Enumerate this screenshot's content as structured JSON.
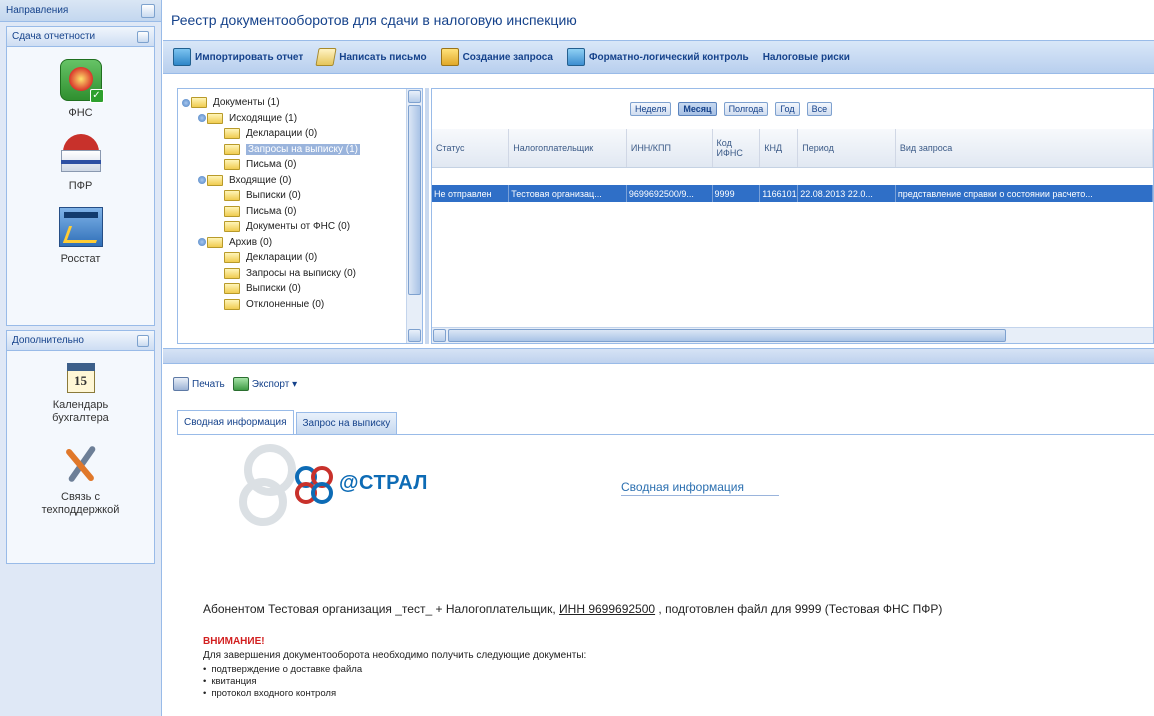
{
  "nav": {
    "header": "Направления",
    "groups": [
      {
        "title": "Сдача отчетности",
        "items": [
          {
            "label": "ФНС",
            "icon": "fns-icon"
          },
          {
            "label": "ПФР",
            "icon": "pfr-icon"
          },
          {
            "label": "Росстат",
            "icon": "rosstat-icon"
          }
        ]
      },
      {
        "title": "Дополнительно",
        "items": [
          {
            "label": "Календарь бухгалтера",
            "icon": "calendar-icon",
            "icon_text": "15"
          },
          {
            "label": "Связь с техподдержкой",
            "icon": "tools-icon"
          }
        ]
      }
    ]
  },
  "page": {
    "title": "Реестр документооборотов для сдачи в налоговую инспекцию"
  },
  "toolbar": {
    "buttons": [
      {
        "label": "Импортировать отчет",
        "icon": "import-icon"
      },
      {
        "label": "Написать письмо",
        "icon": "letter-icon"
      },
      {
        "label": "Создание запроса",
        "icon": "request-icon"
      },
      {
        "label": "Форматно-логический контроль",
        "icon": "check-icon"
      },
      {
        "label": "Налоговые риски",
        "icon": ""
      }
    ]
  },
  "tree": {
    "rows": [
      {
        "label": "Документы (1)",
        "level": 0,
        "expanded": true
      },
      {
        "label": "Исходящие (1)",
        "level": 1,
        "expanded": true
      },
      {
        "label": "Декларации (0)",
        "level": 2
      },
      {
        "label": "Запросы на выписку (1)",
        "level": 2,
        "selected": true
      },
      {
        "label": "Письма (0)",
        "level": 2
      },
      {
        "label": "Входящие (0)",
        "level": 1,
        "expanded": true
      },
      {
        "label": "Выписки (0)",
        "level": 2
      },
      {
        "label": "Письма (0)",
        "level": 2
      },
      {
        "label": "Документы от ФНС (0)",
        "level": 2
      },
      {
        "label": "Архив (0)",
        "level": 1,
        "expanded": true
      },
      {
        "label": "Декларации (0)",
        "level": 2
      },
      {
        "label": "Запросы на выписку (0)",
        "level": 2
      },
      {
        "label": "Выписки (0)",
        "level": 2
      },
      {
        "label": "Отклоненные (0)",
        "level": 2
      }
    ]
  },
  "periods": {
    "buttons": [
      "Неделя",
      "Месяц",
      "Полгода",
      "Год",
      "Все"
    ],
    "active": "Месяц"
  },
  "grid": {
    "columns": [
      "Статус",
      "Налогоплательщик",
      "ИНН/КПП",
      "Код ИФНС",
      "КНД",
      "Период",
      "Вид запроса"
    ],
    "rows": [
      [
        "Не отправлен",
        "Тестовая организац...",
        "9699692500/9...",
        "9999",
        "1166101",
        "22.08.2013 22.0...",
        "представление справки о состоянии расчето..."
      ]
    ]
  },
  "bottom_toolbar": {
    "print_label": "Печать",
    "export_label": "Экспорт ▾"
  },
  "tabs": [
    {
      "label": "Сводная информация",
      "active": true
    },
    {
      "label": "Запрос на выписку",
      "active": false
    }
  ],
  "document": {
    "logo_text": "@СТРАЛ",
    "summary_title": "Сводная информация",
    "subscriber_prefix": "Абонентом Тестовая организация _тест_ + Налогоплательщик, ",
    "inn_link": "ИНН 9699692500",
    "subscriber_suffix": " , подготовлен файл для 9999 (Тестовая ФНС ПФР)",
    "warning": "ВНИМАНИЕ!",
    "instructions": "Для завершения документооборота необходимо получить следующие документы:",
    "required": [
      "подтверждение о доставке файла",
      "квитанция",
      "протокол входного контроля"
    ]
  },
  "colors": {
    "accent": "#15428b",
    "selection": "#2f6fc7",
    "warning": "#d21f1f",
    "panel_border": "#99bbe8"
  }
}
